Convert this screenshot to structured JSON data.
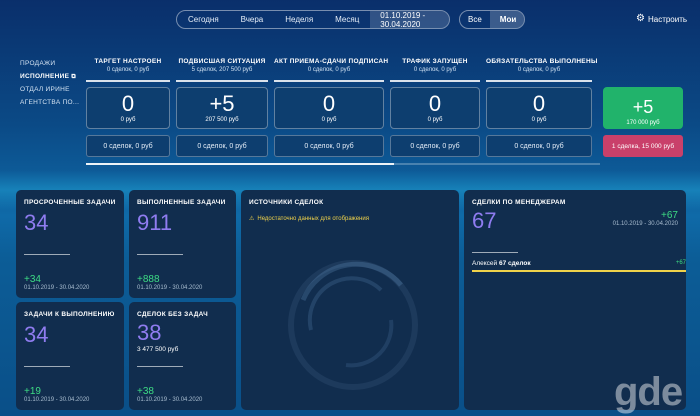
{
  "header": {
    "periods": [
      "Сегодня",
      "Вчера",
      "Неделя",
      "Месяц"
    ],
    "date_range": "01.10.2019 - 30.04.2020",
    "owners": [
      "Все",
      "Мои"
    ],
    "settings_label": "Настроить"
  },
  "nav": {
    "items": [
      {
        "label": "ПРОДАЖИ"
      },
      {
        "label": "ИСПОЛНЕНИЕ"
      },
      {
        "label": "ОТДАЛ ИРИНЕ"
      },
      {
        "label": "АГЕНТСТВА ПО..."
      }
    ],
    "external_icon": "external-link-icon"
  },
  "stages": [
    {
      "title": "ТАРГЕТ НАСТРОЕН",
      "sub": "0 сделок, 0 руб",
      "value": "0",
      "amount": "0 руб",
      "footer": "0 сделок, 0 руб"
    },
    {
      "title": "ПОДВИСШАЯ СИТУАЦИЯ",
      "sub": "5 сделок, 207 500 руб",
      "value": "+5",
      "amount": "207 500 руб",
      "footer": "0 сделок, 0 руб"
    },
    {
      "title": "АКТ ПРИЕМА-СДАЧИ ПОДПИСАН",
      "sub": "0 сделок, 0 руб",
      "value": "0",
      "amount": "0 руб",
      "footer": "0 сделок, 0 руб"
    },
    {
      "title": "ТРАФИК ЗАПУЩЕН",
      "sub": "0 сделок, 0 руб",
      "value": "0",
      "amount": "0 руб",
      "footer": "0 сделок, 0 руб"
    },
    {
      "title": "ОБЯЗАТЕЛЬСТВА ВЫПОЛНЕНЫ",
      "sub": "0 сделок, 0 руб",
      "value": "0",
      "amount": "0 руб",
      "footer": "0 сделок, 0 руб"
    },
    {
      "title": "",
      "sub": "",
      "value": "+5",
      "amount": "170 000 руб",
      "footer": "1 сделка, 15 000 руб"
    }
  ],
  "funnel_progress": 0.6,
  "cards": {
    "overdue": {
      "title": "ПРОСРОЧЕННЫЕ ЗАДАЧИ",
      "value": "34",
      "delta": "+34",
      "range": "01.10.2019 - 30.04.2020"
    },
    "done": {
      "title": "ВЫПОЛНЕННЫЕ ЗАДАЧИ",
      "value": "911",
      "delta": "+888",
      "range": "01.10.2019 - 30.04.2020"
    },
    "todo": {
      "title": "ЗАДАЧИ К ВЫПОЛНЕНИЮ",
      "value": "34",
      "delta": "+19",
      "range": "01.10.2019 - 30.04.2020"
    },
    "no_tasks": {
      "title": "СДЕЛОК БЕЗ ЗАДАЧ",
      "value": "38",
      "extra": "3 477 500 руб",
      "delta": "+38",
      "range": "01.10.2019 - 30.04.2020"
    },
    "sources": {
      "title": "ИСТОЧНИКИ СДЕЛОК",
      "warning": "Недостаточно данных для отображения",
      "warning_icon": "warning-icon"
    },
    "managers": {
      "title": "СДЕЛКИ ПО МЕНЕДЖЕРАМ",
      "value": "67",
      "delta": "+67",
      "range": "01.10.2019 - 30.04.2020",
      "rows": [
        {
          "name": "Алексей",
          "count": "67 сделок",
          "delta": "+67"
        }
      ]
    }
  },
  "colors": {
    "accent_purple": "#8f7cf0",
    "positive_green": "#3ddc84",
    "warning_yellow": "#f0d24a",
    "success_box": "#21b36b",
    "alert_box": "#c9406a"
  },
  "watermark": "gde"
}
